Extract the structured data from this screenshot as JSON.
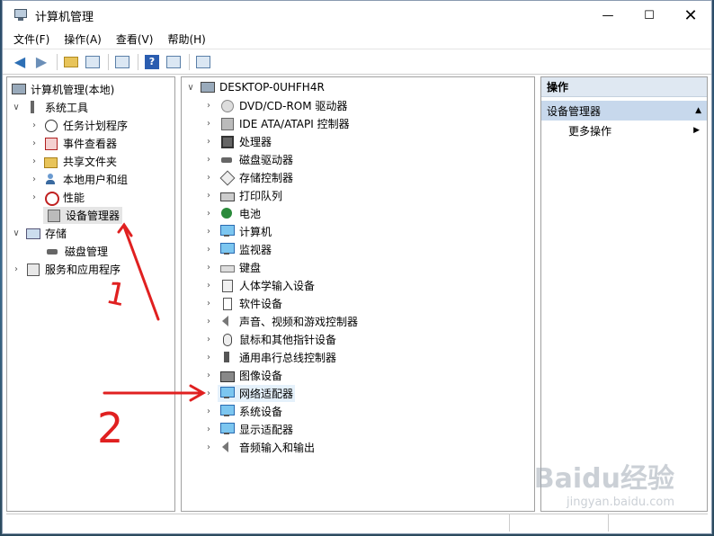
{
  "window": {
    "title": "计算机管理"
  },
  "menu": [
    "文件(F)",
    "操作(A)",
    "查看(V)",
    "帮助(H)"
  ],
  "left_tree": [
    {
      "label": "计算机管理(本地)",
      "icon": "computer-management-icon",
      "level": 0,
      "expander": ""
    },
    {
      "label": "系统工具",
      "icon": "system-tools-icon",
      "level": 1,
      "expander": "v"
    },
    {
      "label": "任务计划程序",
      "icon": "task-scheduler-icon",
      "level": 2,
      "expander": ">"
    },
    {
      "label": "事件查看器",
      "icon": "event-viewer-icon",
      "level": 2,
      "expander": ">"
    },
    {
      "label": "共享文件夹",
      "icon": "shared-folders-icon",
      "level": 2,
      "expander": ">"
    },
    {
      "label": "本地用户和组",
      "icon": "local-users-icon",
      "level": 2,
      "expander": ">"
    },
    {
      "label": "性能",
      "icon": "performance-icon",
      "level": 2,
      "expander": ">"
    },
    {
      "label": "设备管理器",
      "icon": "device-manager-icon",
      "level": 2,
      "expander": "",
      "selected": true
    },
    {
      "label": "存储",
      "icon": "storage-icon",
      "level": 1,
      "expander": "v"
    },
    {
      "label": "磁盘管理",
      "icon": "disk-management-icon",
      "level": 2,
      "expander": ""
    },
    {
      "label": "服务和应用程序",
      "icon": "services-apps-icon",
      "level": 1,
      "expander": ">"
    }
  ],
  "device_root": "DESKTOP-0UHFH4R",
  "devices": [
    {
      "label": "DVD/CD-ROM 驱动器",
      "icon": "dvd-drive-icon"
    },
    {
      "label": "IDE ATA/ATAPI 控制器",
      "icon": "ide-controller-icon"
    },
    {
      "label": "处理器",
      "icon": "processor-icon"
    },
    {
      "label": "磁盘驱动器",
      "icon": "disk-drive-icon"
    },
    {
      "label": "存储控制器",
      "icon": "storage-controller-icon"
    },
    {
      "label": "打印队列",
      "icon": "print-queue-icon"
    },
    {
      "label": "电池",
      "icon": "battery-icon"
    },
    {
      "label": "计算机",
      "icon": "computer-icon"
    },
    {
      "label": "监视器",
      "icon": "monitor-icon"
    },
    {
      "label": "键盘",
      "icon": "keyboard-icon"
    },
    {
      "label": "人体学输入设备",
      "icon": "hid-icon"
    },
    {
      "label": "软件设备",
      "icon": "software-device-icon"
    },
    {
      "label": "声音、视频和游戏控制器",
      "icon": "sound-video-icon"
    },
    {
      "label": "鼠标和其他指针设备",
      "icon": "mouse-icon"
    },
    {
      "label": "通用串行总线控制器",
      "icon": "usb-controller-icon"
    },
    {
      "label": "图像设备",
      "icon": "imaging-device-icon"
    },
    {
      "label": "网络适配器",
      "icon": "network-adapter-icon",
      "selected": true
    },
    {
      "label": "系统设备",
      "icon": "system-device-icon"
    },
    {
      "label": "显示适配器",
      "icon": "display-adapter-icon"
    },
    {
      "label": "音频输入和输出",
      "icon": "audio-io-icon"
    }
  ],
  "actions": {
    "header": "操作",
    "section": "设备管理器",
    "more": "更多操作"
  },
  "annotations": {
    "one": "1",
    "two": "2",
    "color": "#e02020"
  },
  "watermark": {
    "brand": "Baidu经验",
    "url": "jingyan.baidu.com"
  }
}
